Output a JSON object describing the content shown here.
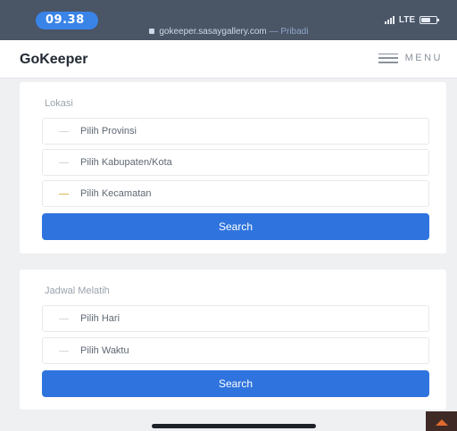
{
  "status_bar": {
    "time": "09.38",
    "network": "LTE",
    "url": "gokeeper.sasaygallery.com",
    "url_suffix": "— Pribadi"
  },
  "header": {
    "brand": "GoKeeper",
    "menu_label": "MENU",
    "menu_icon": "hamburger-icon"
  },
  "lokasi": {
    "title": "Lokasi",
    "provinsi_placeholder": "Pilih Provinsi",
    "kabupaten_placeholder": "Pilih Kabupaten/Kota",
    "kecamatan_placeholder": "Pilih Kecamatan",
    "search_label": "Search"
  },
  "jadwal": {
    "title": "Jadwal Melatih",
    "hari_placeholder": "Pilih Hari",
    "waktu_placeholder": "Pilih Waktu",
    "search_label": "Search"
  },
  "colors": {
    "primary": "#2f74de",
    "status_bar": "#4a5566",
    "time_pill": "#3a84e8",
    "scroll_top_arrow": "#e06a2c"
  },
  "icons": {
    "scroll_top": "caret-up-icon",
    "select_indicator": "chevron-down-icon"
  }
}
